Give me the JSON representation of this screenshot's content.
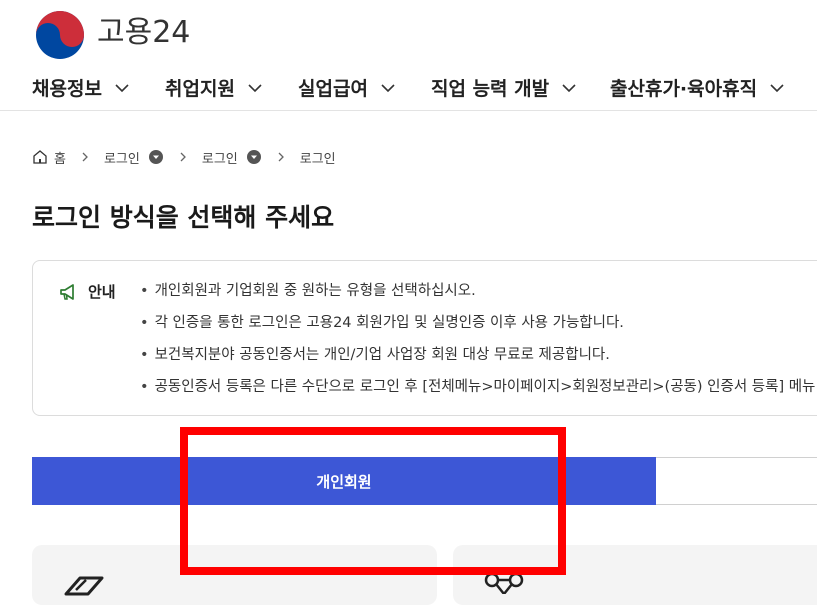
{
  "header": {
    "logo_text": "고용24",
    "nav": [
      {
        "label": "채용정보"
      },
      {
        "label": "취업지원"
      },
      {
        "label": "실업급여"
      },
      {
        "label": "직업 능력 개발"
      },
      {
        "label": "출산휴가·육아휴직"
      }
    ]
  },
  "breadcrumb": {
    "home": "홈",
    "items": [
      "로그인",
      "로그인",
      "로그인"
    ]
  },
  "page_title": "로그인 방식을 선택해 주세요",
  "info": {
    "label": "안내",
    "items": [
      "개인회원과 기업회원 중 원하는 유형을 선택하십시오.",
      "각 인증을 통한 로그인은 고용24 회원가입 및 실명인증 이후 사용 가능합니다.",
      "보건복지분야 공동인증서는 개인/기업 사업장 회원 대상 무료로 제공합니다.",
      "공동인증서 등록은 다른 수단으로 로그인 후 [전체메뉴>마이페이지>회원정보관리>(공동) 인증서 등록] 메뉴"
    ]
  },
  "tabs": {
    "active": "개인회원"
  },
  "colors": {
    "accent": "#3d57d6",
    "highlight": "#ff0000",
    "logo_red": "#cd2e3a",
    "logo_blue": "#0047a0",
    "info_icon": "#2e7d32"
  }
}
